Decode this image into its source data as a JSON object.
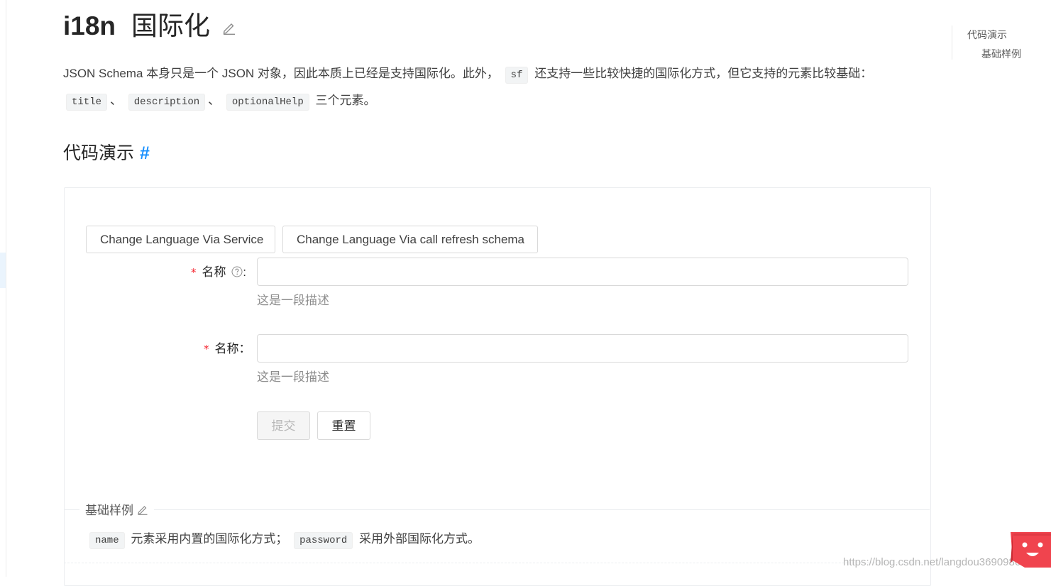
{
  "header": {
    "title_main": "i18n",
    "title_sub": "国际化"
  },
  "intro": {
    "text_1": "JSON Schema 本身只是一个 JSON 对象，因此本质上已经是支持国际化。此外，",
    "code_sf": "sf",
    "text_2": "还支持一些比较快捷的国际化方式，但它支持的元素比较基础：",
    "code_title": "title",
    "sep_1": "、",
    "code_description": "description",
    "sep_2": "、",
    "code_optionalHelp": "optionalHelp",
    "text_3": "三个元素。"
  },
  "section": {
    "heading": "代码演示",
    "anchor": "#"
  },
  "toc": {
    "items": [
      "代码演示",
      "基础样例"
    ]
  },
  "demo": {
    "buttons": {
      "lang_service": "Change Language Via Service",
      "lang_refresh": "Change Language Via call refresh schema"
    },
    "fields": [
      {
        "required_mark": "*",
        "label": "名称",
        "colon": ":",
        "value": "",
        "description": "这是一段描述"
      },
      {
        "required_mark": "*",
        "label": "名称",
        "colon": "：",
        "value": "",
        "description": "这是一段描述"
      }
    ],
    "submit_label": "提交",
    "reset_label": "重置"
  },
  "meta": {
    "title": "基础样例",
    "code_name": "name",
    "text_1": "元素采用内置的国际化方式；",
    "code_password": "password",
    "text_2": "采用外部国际化方式。"
  },
  "watermark": "https://blog.csdn.net/langdou369098655",
  "colors": {
    "accent": "#1890ff",
    "required": "#f5222d",
    "float_button": "#f0444e"
  }
}
